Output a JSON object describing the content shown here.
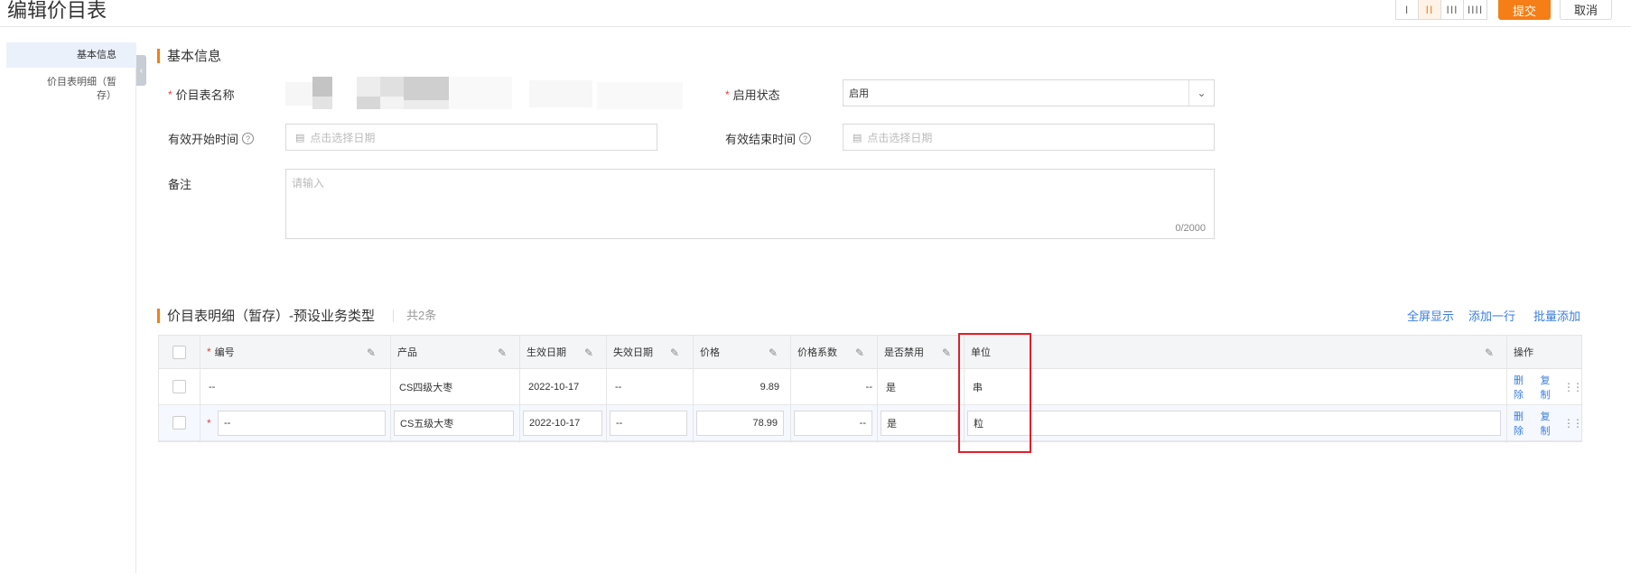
{
  "header": {
    "title": "编辑价目表",
    "layout_options": [
      "I",
      "II",
      "III",
      "IIII"
    ],
    "submit_label": "提交",
    "cancel_label": "取消"
  },
  "sidenav": {
    "items": [
      {
        "label": "基本信息",
        "active": true
      },
      {
        "label_line1": "价目表明细（暂",
        "label_line2": "存）",
        "active": false
      }
    ]
  },
  "basic_info": {
    "section_title": "基本信息",
    "name_label": "价目表名称",
    "status_label": "启用状态",
    "status_value": "启用",
    "start_time_label": "有效开始时间",
    "end_time_label": "有效结束时间",
    "date_placeholder": "点击选择日期",
    "remark_label": "备注",
    "remark_placeholder": "请输入",
    "remark_counter": "0/2000"
  },
  "detail": {
    "section_title": "价目表明细（暂存）-预设业务类型",
    "count_text": "共2条",
    "actions": {
      "fullscreen": "全屏显示",
      "add_row": "添加一行",
      "batch_add": "批量添加"
    },
    "columns": {
      "code": "编号",
      "product": "产品",
      "effective_date": "生效日期",
      "expiry_date": "失效日期",
      "price": "价格",
      "price_factor": "价格系数",
      "disabled": "是否禁用",
      "unit": "单位",
      "operation": "操作"
    },
    "rows": [
      {
        "code": "--",
        "product": "CS四级大枣",
        "effective_date": "2022-10-17",
        "expiry_date": "--",
        "price": "9.89",
        "price_factor": "--",
        "disabled": "是",
        "unit": "串",
        "delete": "删除",
        "copy": "复制"
      },
      {
        "code": "--",
        "product": "CS五级大枣",
        "effective_date": "2022-10-17",
        "expiry_date": "--",
        "price": "78.99",
        "price_factor": "--",
        "disabled": "是",
        "unit": "粒",
        "delete": "删除",
        "copy": "复制"
      }
    ]
  },
  "colors": {
    "accent": "#f57e16",
    "link": "#3a7de0",
    "required": "#e2423a",
    "highlight": "#e0202a"
  },
  "icons": {
    "collapse": "chevron-left-icon",
    "select_arrow": "chevron-down-icon",
    "calendar": "calendar-icon",
    "help": "question-circle-icon",
    "edit": "pencil-icon",
    "drag": "drag-handle-icon"
  }
}
